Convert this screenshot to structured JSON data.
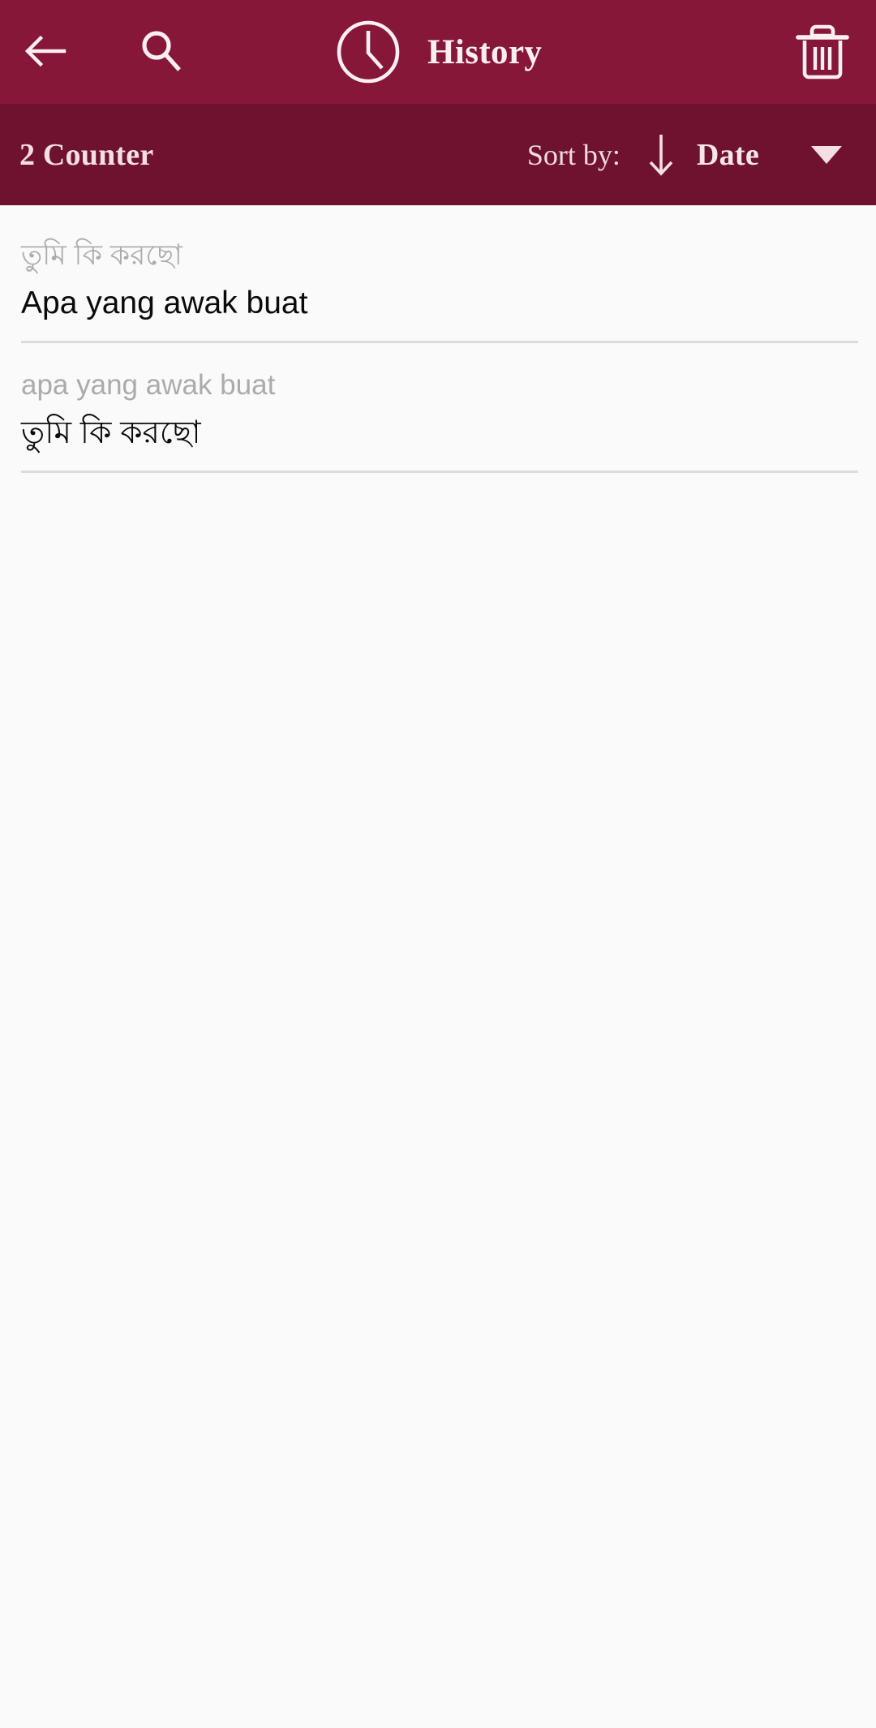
{
  "header": {
    "back_icon": "back-arrow-icon",
    "search_icon": "search-icon",
    "clock_icon": "clock-icon",
    "title": "History",
    "delete_icon": "trash-icon",
    "background_color": "#861739",
    "text_color": "#FBEFF2"
  },
  "subbar": {
    "counter_label": "2 Counter",
    "sort_by_label": "Sort by:",
    "sort_direction_icon": "arrow-down-icon",
    "sort_value": "Date",
    "dropdown_icon": "caret-down-icon",
    "background_color": "#6E1230",
    "text_color": "#F4DFE5"
  },
  "history": {
    "items": [
      {
        "source_text": "তুমি কি করছো",
        "target_text": "Apa yang awak buat"
      },
      {
        "source_text": "apa yang awak buat",
        "target_text": "তুমি কি করছো"
      }
    ]
  },
  "colors": {
    "page_background": "#FAFAFA",
    "source_text": "#ABABAB",
    "target_text": "#0A0A0A",
    "divider": "#DCDCDC"
  }
}
